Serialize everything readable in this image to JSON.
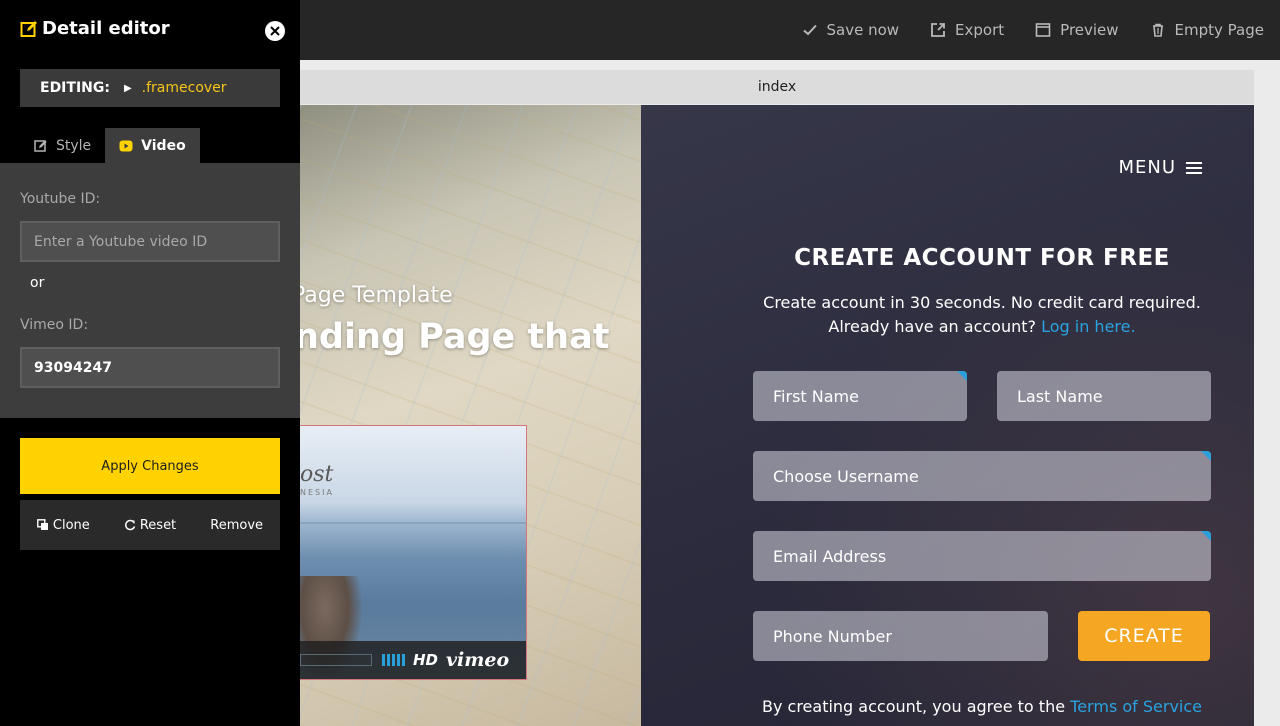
{
  "toolbar": {
    "save": "Save now",
    "export": "Export",
    "preview": "Preview",
    "empty": "Empty Page"
  },
  "frame": {
    "tab": "index"
  },
  "hero": {
    "subtitle": "Page Template",
    "title": "nding Page that"
  },
  "video": {
    "logo_text": "ost",
    "logo_sub": "NESIA",
    "hd_label": "HD",
    "brand": "vimeo"
  },
  "form": {
    "menu": "MENU",
    "title": "CREATE ACCOUNT FOR FREE",
    "line1": "Create account in 30 seconds. No credit card required.",
    "line2_prefix": "Already have an account?",
    "login_link": "Log in here.",
    "first_name": "First Name",
    "last_name": "Last Name",
    "username": "Choose Username",
    "email": "Email Address",
    "phone": "Phone Number",
    "create": "CREATE",
    "terms_prefix": "By creating account, you agree to the",
    "terms_link": "Terms of Service"
  },
  "editor": {
    "title": "Detail editor",
    "editing_label": "EDITING:",
    "editing_target": ".framecover",
    "tabs": [
      "Style",
      "Video"
    ],
    "active_tab": "Video",
    "youtube_label": "Youtube ID:",
    "youtube_placeholder": "Enter a Youtube video ID",
    "youtube_value": "",
    "or_label": "or",
    "vimeo_label": "Vimeo ID:",
    "vimeo_value": "93094247",
    "apply": "Apply Changes",
    "clone": "Clone",
    "reset": "Reset",
    "remove": "Remove"
  },
  "colors": {
    "accent_yellow": "#ffd200",
    "cta_orange": "#f5a623",
    "link_blue": "#2aa3e0"
  },
  "icons": {
    "editor": "edit-icon",
    "close": "close-icon",
    "save": "check-icon",
    "export": "export-icon",
    "preview": "window-icon",
    "empty": "trash-icon",
    "style_tab": "edit-icon",
    "video_tab": "play-icon",
    "clone": "copy-icon",
    "reset": "refresh-icon",
    "menu": "hamburger-icon"
  }
}
